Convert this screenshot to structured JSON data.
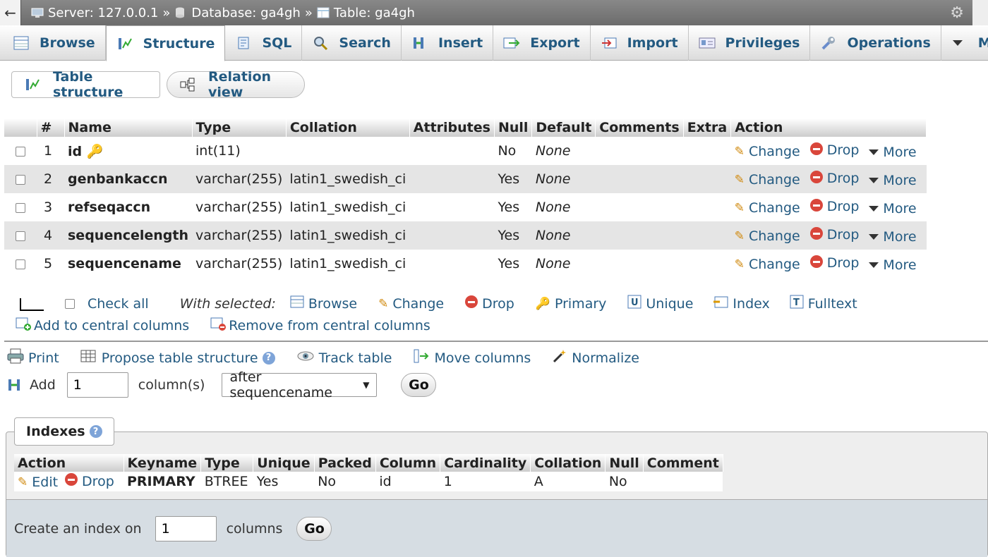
{
  "topbar": {
    "back": "←",
    "server": "Server: 127.0.0.1",
    "database": "Database: ga4gh",
    "table": "Table: ga4gh",
    "sep": "»"
  },
  "tabs": [
    {
      "label": "Browse",
      "icon": "browse-icon"
    },
    {
      "label": "Structure",
      "icon": "structure-icon",
      "active": true
    },
    {
      "label": "SQL",
      "icon": "sql-icon"
    },
    {
      "label": "Search",
      "icon": "search-icon"
    },
    {
      "label": "Insert",
      "icon": "insert-icon"
    },
    {
      "label": "Export",
      "icon": "export-icon"
    },
    {
      "label": "Import",
      "icon": "import-icon"
    },
    {
      "label": "Privileges",
      "icon": "privileges-icon"
    },
    {
      "label": "Operations",
      "icon": "wrench-icon"
    },
    {
      "label": "More",
      "icon": "chevron-down-icon"
    }
  ],
  "subtabs": {
    "table_structure": "Table structure",
    "relation_view": "Relation view"
  },
  "structure": {
    "headers": [
      "#",
      "Name",
      "Type",
      "Collation",
      "Attributes",
      "Null",
      "Default",
      "Comments",
      "Extra",
      "Action"
    ],
    "rows": [
      {
        "num": "1",
        "name": "id",
        "type": "int(11)",
        "collation": "",
        "null": "No",
        "default": "None",
        "primary": true
      },
      {
        "num": "2",
        "name": "genbankaccn",
        "type": "varchar(255)",
        "collation": "latin1_swedish_ci",
        "null": "Yes",
        "default": "None"
      },
      {
        "num": "3",
        "name": "refseqaccn",
        "type": "varchar(255)",
        "collation": "latin1_swedish_ci",
        "null": "Yes",
        "default": "None"
      },
      {
        "num": "4",
        "name": "sequencelength",
        "type": "varchar(255)",
        "collation": "latin1_swedish_ci",
        "null": "Yes",
        "default": "None"
      },
      {
        "num": "5",
        "name": "sequencename",
        "type": "varchar(255)",
        "collation": "latin1_swedish_ci",
        "null": "Yes",
        "default": "None"
      }
    ],
    "actions": {
      "change": "Change",
      "drop": "Drop",
      "more": "More"
    }
  },
  "with_selected": {
    "check_all": "Check all",
    "label": "With selected:",
    "browse": "Browse",
    "change": "Change",
    "drop": "Drop",
    "primary": "Primary",
    "unique": "Unique",
    "index": "Index",
    "fulltext": "Fulltext",
    "add_central": "Add to central columns",
    "remove_central": "Remove from central columns"
  },
  "tools": {
    "print": "Print",
    "propose": "Propose table structure",
    "track": "Track table",
    "move": "Move columns",
    "normalize": "Normalize"
  },
  "add_columns": {
    "label": "Add",
    "value": "1",
    "unit": "column(s)",
    "position": "after sequencename",
    "go": "Go"
  },
  "indexes": {
    "legend": "Indexes",
    "headers": [
      "Action",
      "Keyname",
      "Type",
      "Unique",
      "Packed",
      "Column",
      "Cardinality",
      "Collation",
      "Null",
      "Comment"
    ],
    "row": {
      "edit": "Edit",
      "drop": "Drop",
      "keyname": "PRIMARY",
      "type": "BTREE",
      "unique": "Yes",
      "packed": "No",
      "column": "id",
      "cardinality": "1",
      "collation": "A",
      "null": "No",
      "comment": ""
    },
    "create_label": "Create an index on",
    "create_value": "1",
    "create_unit": "columns",
    "go": "Go"
  }
}
